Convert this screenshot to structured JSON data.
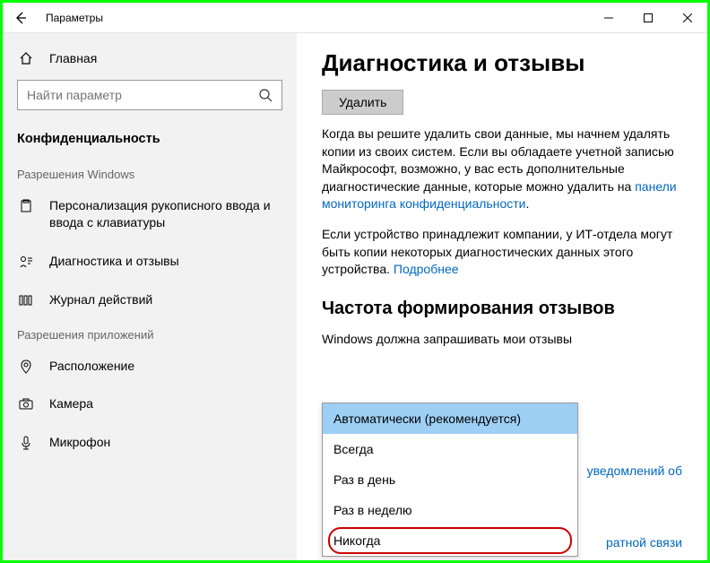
{
  "window": {
    "title": "Параметры"
  },
  "sidebar": {
    "home": "Главная",
    "search_placeholder": "Найти параметр",
    "current_section": "Конфиденциальность",
    "group1": "Разрешения Windows",
    "group2": "Разрешения приложений",
    "items": {
      "ink": "Персонализация рукописного ввода и ввода с клавиатуры",
      "diag": "Диагностика и отзывы",
      "activity": "Журнал действий",
      "location": "Расположение",
      "camera": "Камера",
      "mic": "Микрофон"
    }
  },
  "content": {
    "heading": "Диагностика и отзывы",
    "delete_btn": "Удалить",
    "para1_a": "Когда вы решите удалить свои данные, мы начнем удалять копии из своих систем. Если вы обладаете учетной записью Майкрософт, возможно, у вас есть дополнительные диагностические данные, которые можно удалить на ",
    "para1_link": "панели мониторинга конфиденциальности",
    "para1_b": ".",
    "para2_a": "Если устройство принадлежит компании, у ИТ-отдела могут быть копии некоторых диагностических данных этого устройства. ",
    "para2_link": "Подробнее",
    "sub_heading": "Частота формирования отзывов",
    "freq_label": "Windows должна запрашивать мои отзывы",
    "options": {
      "auto": "Автоматически (рекомендуется)",
      "always": "Всегда",
      "daily": "Раз в день",
      "weekly": "Раз в неделю",
      "never": "Никогда"
    },
    "bg_link1": "уведомлений об",
    "bg_link2": "ратной связи"
  }
}
